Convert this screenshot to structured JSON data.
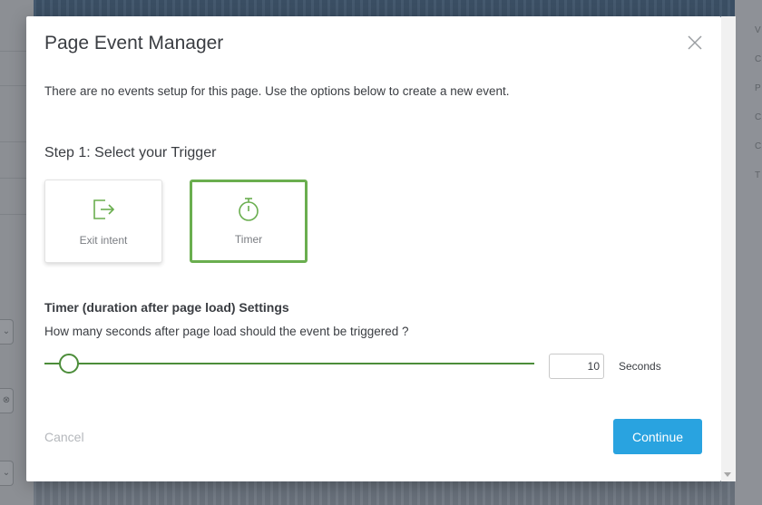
{
  "modal": {
    "title": "Page Event Manager",
    "intro": "There are no events setup for this page. Use the options below to create a new event.",
    "step_label": "Step 1: Select your Trigger",
    "triggers": [
      {
        "label": "Exit intent",
        "icon": "exit-icon",
        "selected": false
      },
      {
        "label": "Timer",
        "icon": "stopwatch-icon",
        "selected": true
      }
    ],
    "settings": {
      "heading": "Timer (duration after page load) Settings",
      "question": "How many seconds after page load should the event be triggered ?",
      "slider_fraction": 0.05,
      "value": "10",
      "unit_label": "Seconds"
    },
    "actions": {
      "cancel_label": "Cancel",
      "continue_label": "Continue"
    }
  },
  "colors": {
    "accent_green": "#6aae4f",
    "slider_green": "#4c8d3a",
    "primary_blue": "#29a3e0"
  },
  "background": {
    "right_panel_letters": [
      "V",
      "C",
      "P",
      "C",
      "C",
      "T"
    ]
  }
}
